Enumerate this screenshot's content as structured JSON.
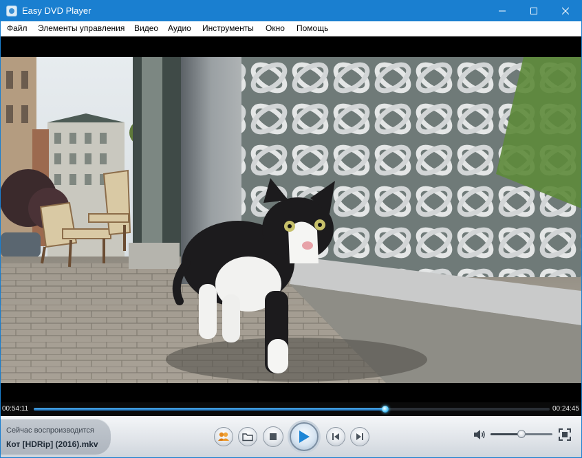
{
  "window": {
    "title": "Easy DVD Player",
    "accent_color": "#1a7fd0"
  },
  "menu": {
    "items": [
      "Файл",
      "Элементы управления",
      "Видео",
      "Аудио",
      "Инструменты",
      "Окно",
      "Помощь"
    ]
  },
  "playback": {
    "elapsed": "00:54:11",
    "remaining": "00:24:45",
    "progress_fraction": 0.682,
    "volume_fraction": 0.5
  },
  "now_playing": {
    "label": "Сейчас воспроизводится",
    "file_name": "Кот [HDRip] (2016).mkv"
  },
  "controls": {
    "buttons": [
      "users-icon",
      "folder-icon",
      "stop-icon",
      "play-icon",
      "previous-icon",
      "next-icon"
    ],
    "volume_icon": "speaker-icon",
    "fullscreen_icon": "fullscreen-icon"
  }
}
